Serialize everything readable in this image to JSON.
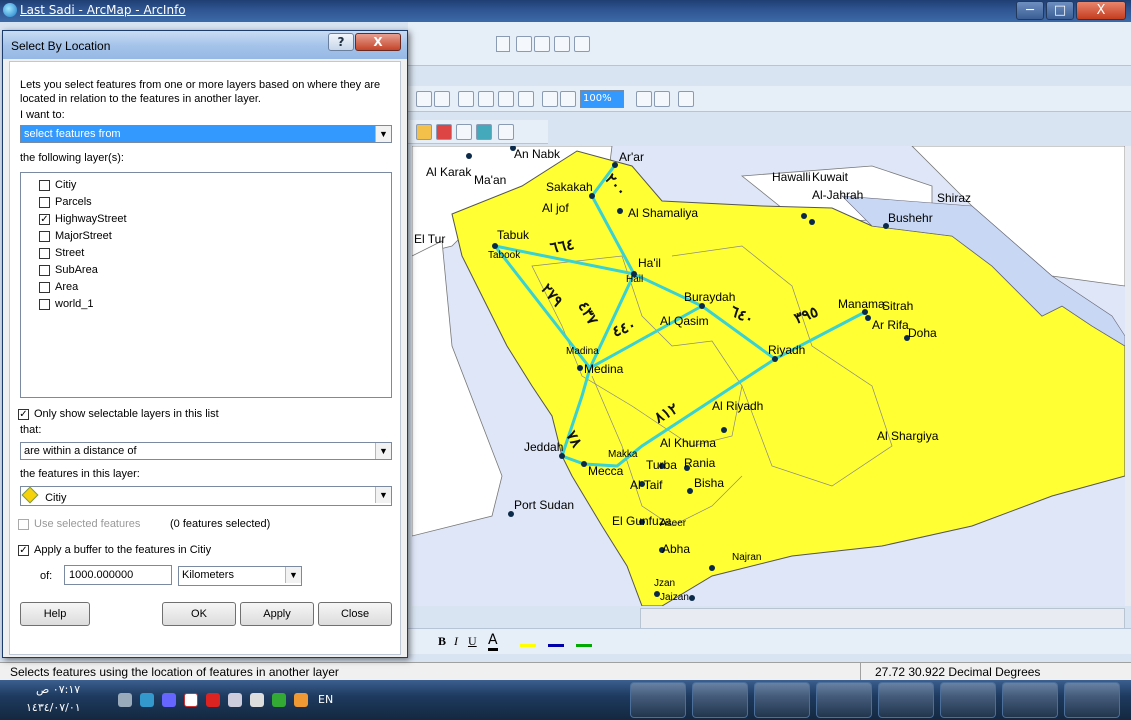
{
  "window": {
    "title": "Last Sadi - ArcMap - ArcInfo",
    "min": "─",
    "max": "□",
    "close": "X"
  },
  "dialog": {
    "title": "Select By Location",
    "help_glyph": "?",
    "close_glyph": "X",
    "description": "Lets you select features from one or more layers based on where they are",
    "description2": "located in relation to the features in another layer.",
    "i_want_to_label": "I want to:",
    "i_want_to_value": "select features from",
    "following_layers_label": "the following layer(s):",
    "layers": [
      {
        "name": "Citiy",
        "checked": false
      },
      {
        "name": "Parcels",
        "checked": false
      },
      {
        "name": "HighwayStreet",
        "checked": true
      },
      {
        "name": "MajorStreet",
        "checked": false
      },
      {
        "name": "Street",
        "checked": false
      },
      {
        "name": "SubArea",
        "checked": false
      },
      {
        "name": "Area",
        "checked": false
      },
      {
        "name": "world_1",
        "checked": false
      }
    ],
    "only_selectable_label": "Only show selectable layers in this list",
    "that_label": "that:",
    "that_value": "are within a distance of",
    "features_layer_label": "the features in this layer:",
    "features_layer_value": "Citiy",
    "use_selected_label": "Use selected features",
    "features_selected": "(0 features selected)",
    "buffer_label": "Apply a buffer to the features in Citiy",
    "of_label": "of:",
    "buffer_value": "1000.000000",
    "unit_value": "Kilometers",
    "buttons": {
      "help": "Help",
      "ok": "OK",
      "apply": "Apply",
      "close": "Close"
    }
  },
  "toolbar": {
    "zoom_value": "100%"
  },
  "map": {
    "labels": [
      {
        "text": "An Nabk"
      },
      {
        "text": "Ar'ar"
      },
      {
        "text": "Al Karak"
      },
      {
        "text": "Ma'an"
      },
      {
        "text": "Sakakah"
      },
      {
        "text": "Al jof"
      },
      {
        "text": "Al Shamaliya"
      },
      {
        "text": "Hawalli"
      },
      {
        "text": "Kuwait"
      },
      {
        "text": "Al-Jahrah"
      },
      {
        "text": "Shiraz"
      },
      {
        "text": "Bushehr"
      },
      {
        "text": "El Tur"
      },
      {
        "text": "Tabuk"
      },
      {
        "text": "Tabook"
      },
      {
        "text": "Ha'il"
      },
      {
        "text": "Hail"
      },
      {
        "text": "Buraydah"
      },
      {
        "text": "Al Qasim"
      },
      {
        "text": "Manama"
      },
      {
        "text": "Sitrah"
      },
      {
        "text": "Ar Rifa"
      },
      {
        "text": "Doha"
      },
      {
        "text": "Madina"
      },
      {
        "text": "Medina"
      },
      {
        "text": "Riyadh"
      },
      {
        "text": "Al Riyadh"
      },
      {
        "text": "Al Shargiya"
      },
      {
        "text": "Jeddah"
      },
      {
        "text": "Makka"
      },
      {
        "text": "Al Khurma"
      },
      {
        "text": "Mecca"
      },
      {
        "text": "Turba"
      },
      {
        "text": "Rania"
      },
      {
        "text": "Al Taif"
      },
      {
        "text": "Bisha"
      },
      {
        "text": "Port Sudan"
      },
      {
        "text": "El Gunfuza"
      },
      {
        "text": "Aseer"
      },
      {
        "text": "Abha"
      },
      {
        "text": "Najran"
      },
      {
        "text": "Jzan"
      },
      {
        "text": "Jaizan"
      }
    ],
    "distance_labels": [
      "٢٠٠",
      "٦٦٤",
      "٢٧٩",
      "٤٣٧",
      "٤٤٠",
      "٦٤٠",
      "٣٩٥",
      "٨١٢",
      "٧٨"
    ]
  },
  "status": {
    "message": "Selects features using the location of features in another layer",
    "coords": "27.72  30.922 Decimal Degrees"
  },
  "taskbar": {
    "time": "٠٧:١٧ ص",
    "date": "١٤٣٤/٠٧/٠١",
    "lang": "EN"
  }
}
